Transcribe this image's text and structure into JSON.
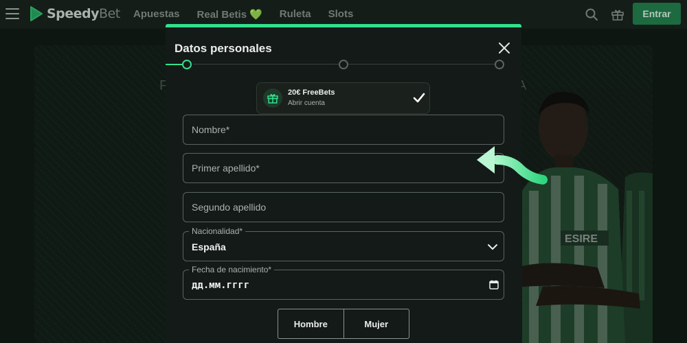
{
  "navbar": {
    "logo_bold": "Speedy",
    "logo_light": "Bet",
    "links": [
      "Apuestas",
      "Real Betis",
      "Ruleta",
      "Slots"
    ],
    "heart": "💚",
    "login_label": "Entrar"
  },
  "hero": {
    "text_left": "P",
    "text_right": "A"
  },
  "modal": {
    "title": "Datos personales",
    "bonus": {
      "title": "20€ FreeBets",
      "subtitle": "Abrir cuenta"
    },
    "fields": {
      "nombre_placeholder": "Nombre*",
      "apellido1_placeholder": "Primer apellido*",
      "apellido2_placeholder": "Segundo apellido",
      "nacionalidad_label": "Nacionalidad*",
      "nacionalidad_value": "España",
      "fecha_label": "Fecha de nacimiento*",
      "fecha_value": "дд.мм.гггг"
    },
    "gender": {
      "male": "Hombre",
      "female": "Mujer"
    }
  },
  "colors": {
    "accent": "#35e08a",
    "modal_bg": "#141a17",
    "page_bg": "#0e1612"
  }
}
